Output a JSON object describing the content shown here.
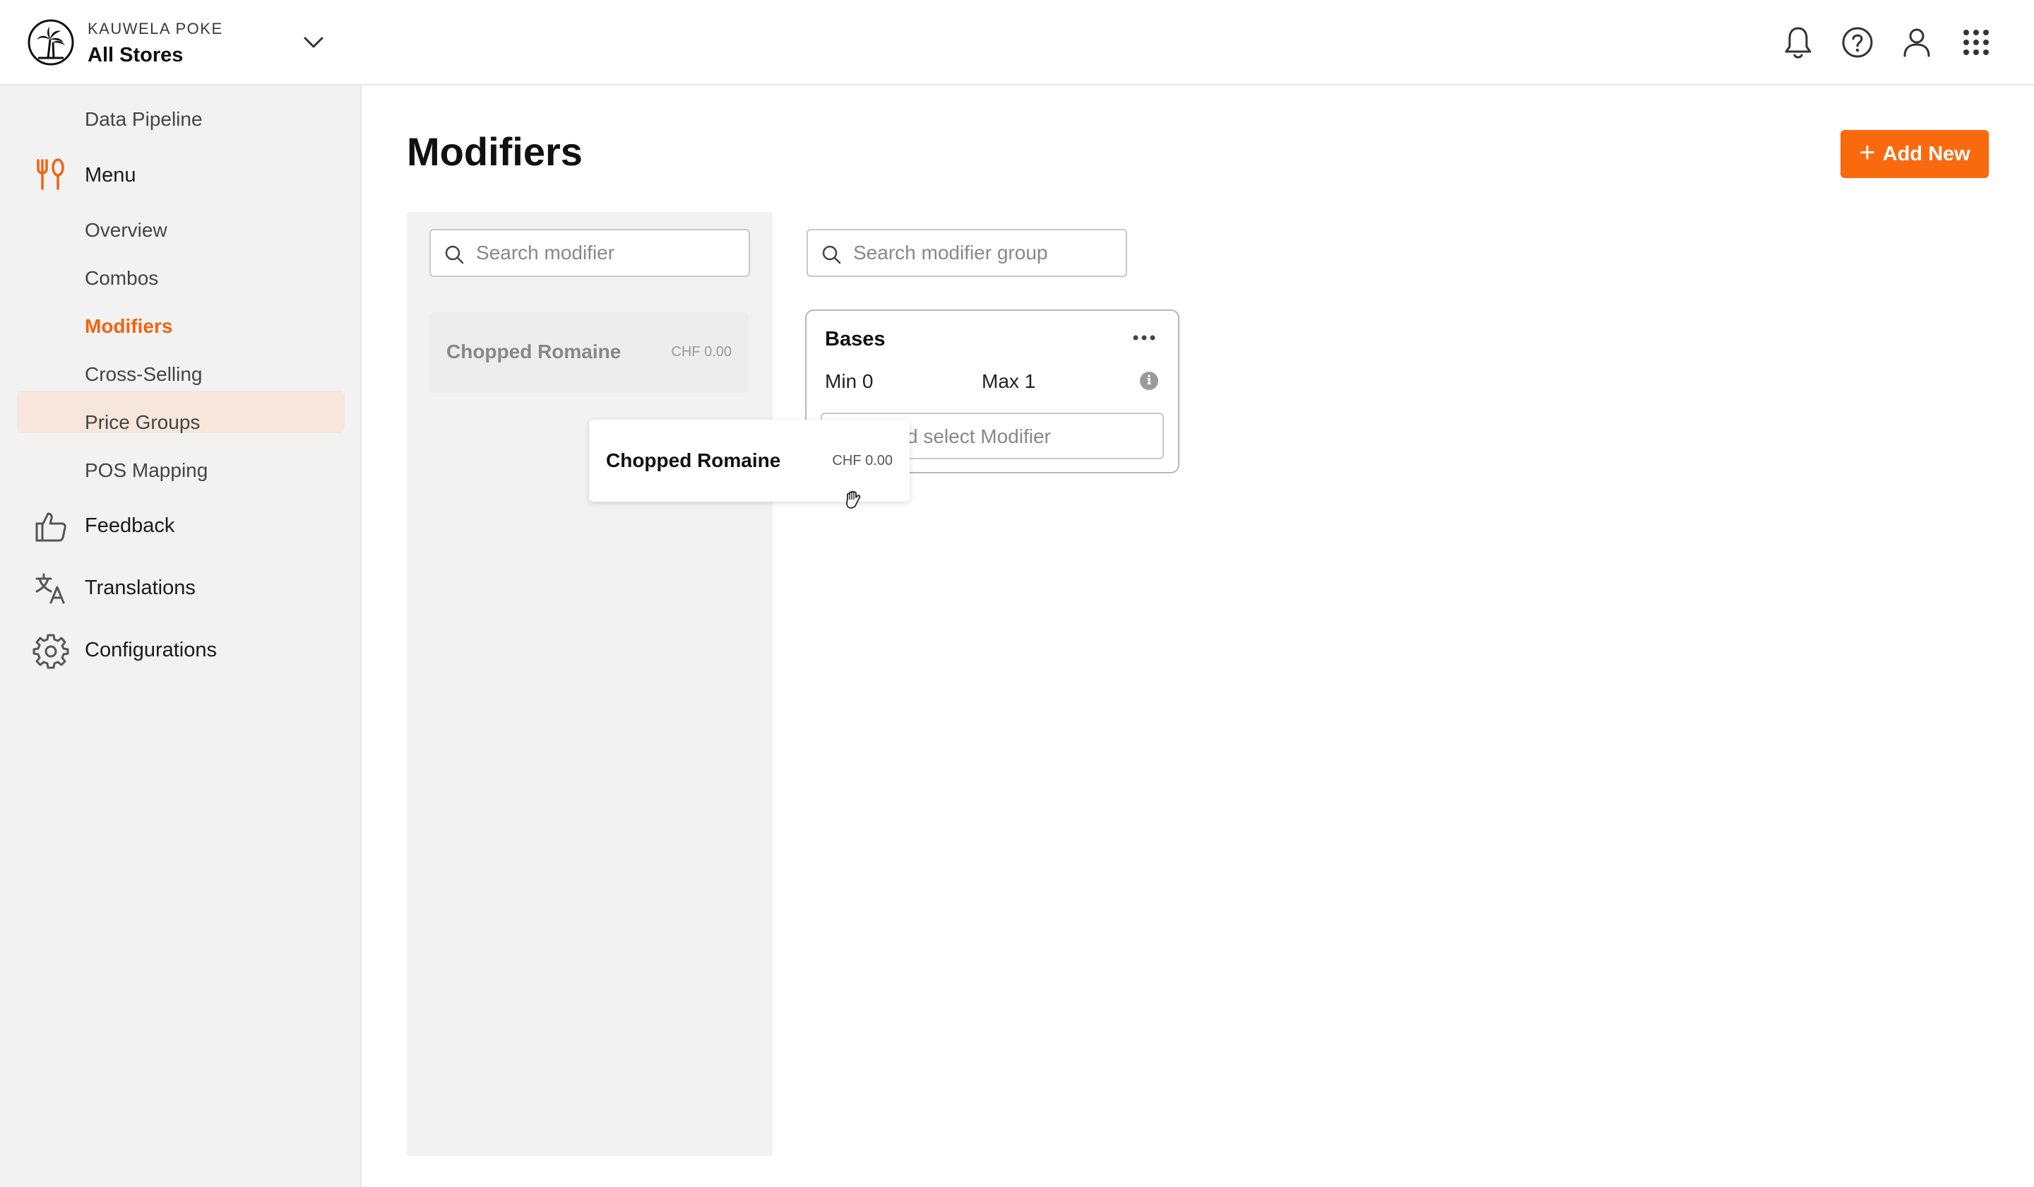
{
  "header": {
    "brand_name": "KAUWELA POKE",
    "store": "All Stores",
    "icons": [
      "notifications-icon",
      "help-icon",
      "user-icon",
      "apps-grid-icon"
    ]
  },
  "sidebar": {
    "items": [
      {
        "label": "Data Pipeline",
        "level": "sub"
      },
      {
        "label": "Menu",
        "level": "main",
        "icon": "utensils-icon",
        "active_section": true
      },
      {
        "label": "Overview",
        "level": "sub"
      },
      {
        "label": "Combos",
        "level": "sub"
      },
      {
        "label": "Modifiers",
        "level": "sub",
        "active": true
      },
      {
        "label": "Cross-Selling",
        "level": "sub"
      },
      {
        "label": "Price Groups",
        "level": "sub"
      },
      {
        "label": "POS Mapping",
        "level": "sub"
      },
      {
        "label": "Feedback",
        "level": "main",
        "icon": "thumbs-up-icon"
      },
      {
        "label": "Translations",
        "level": "main",
        "icon": "translate-icon"
      },
      {
        "label": "Configurations",
        "level": "main",
        "icon": "gear-icon"
      }
    ]
  },
  "main": {
    "title": "Modifiers",
    "add_button": "Add New",
    "modifier_search": {
      "placeholder": "Search modifier"
    },
    "group_search": {
      "placeholder": "Search modifier group"
    },
    "modifiers": [
      {
        "name": "Chopped Romaine",
        "price": "CHF 0.00"
      }
    ],
    "groups": [
      {
        "name": "Bases",
        "min": "Min 0",
        "max": "Max 1",
        "select_placeholder": "Search and select Modifier",
        "select_visible_text": "d select Modifier"
      }
    ],
    "dragging": {
      "name": "Chopped Romaine",
      "price": "CHF 0.00"
    }
  },
  "colors": {
    "accent": "#f96a0e",
    "active_text": "#f06312",
    "active_bg": "#f6e6dc",
    "sidebar_bg": "#f2f2f2"
  }
}
